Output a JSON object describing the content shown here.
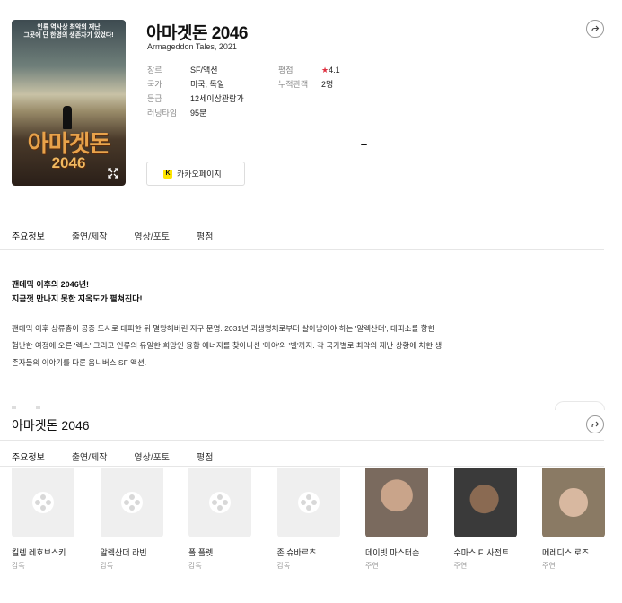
{
  "poster": {
    "tagline_line1": "인류 역사상 최악의 재난",
    "tagline_line2": "그곳에 단 한명의 생존자가 있었다!",
    "title_text": "아마겟돈",
    "year_text": "2046"
  },
  "movie": {
    "title": "아마겟돈 2046",
    "original_title": "Armageddon Tales, 2021"
  },
  "info_left": [
    {
      "label": "장르",
      "value": "SF/액션"
    },
    {
      "label": "국가",
      "value": "미국, 독일"
    },
    {
      "label": "등급",
      "value": "12세이상관람가"
    },
    {
      "label": "러닝타임",
      "value": "95분"
    }
  ],
  "info_right": {
    "rating_label": "평점",
    "rating_star": "★",
    "rating_value": "4.1",
    "audience_label": "누적관객",
    "audience_value": "2명"
  },
  "kakao_button": {
    "label": "카카오페이지",
    "icon": "K"
  },
  "tabs": [
    "주요정보",
    "출연/제작",
    "영상/포토",
    "평점"
  ],
  "synopsis": {
    "headline1": "팬데믹 이후의 2046년!",
    "headline2": "지금껏 만나지 못한 지옥도가 펼쳐진다!",
    "body": "팬데믹 이후 상류층이 공중 도시로 대피한 뒤 멸망해버린 지구 문명. 2031년 괴생명체로부터 살아남아야 하는 '알렉산더', 대피소를 향한 험난한 여정에 오른 '렉스' 그리고 인류의 유일한 희망인 융합 에너지를 찾아나선 '마야'와 '벨'까지. 각 국가별로 최악의 재난 상황에 처한 생존자들의 이야기를 다룬 옴니버스 SF 액션."
  },
  "sticky_title": "아마겟돈 2046",
  "cast": [
    {
      "name": "킬렘 레호브스키",
      "role": "감독",
      "photo": "placeholder"
    },
    {
      "name": "알렉산더 라빈",
      "role": "감독",
      "photo": "placeholder"
    },
    {
      "name": "폴 플렛",
      "role": "감독",
      "photo": "placeholder"
    },
    {
      "name": "존 슈바르츠",
      "role": "감독",
      "photo": "placeholder"
    },
    {
      "name": "데이빗 마스터슨",
      "role": "주연",
      "photo": "face"
    },
    {
      "name": "수마스 F. 사전트",
      "role": "주연",
      "photo": "face"
    },
    {
      "name": "메레디스 로즈",
      "role": "주연",
      "photo": "face"
    }
  ],
  "colors": {
    "accent_star": "#e03040",
    "kakao_yellow": "#fee500"
  }
}
